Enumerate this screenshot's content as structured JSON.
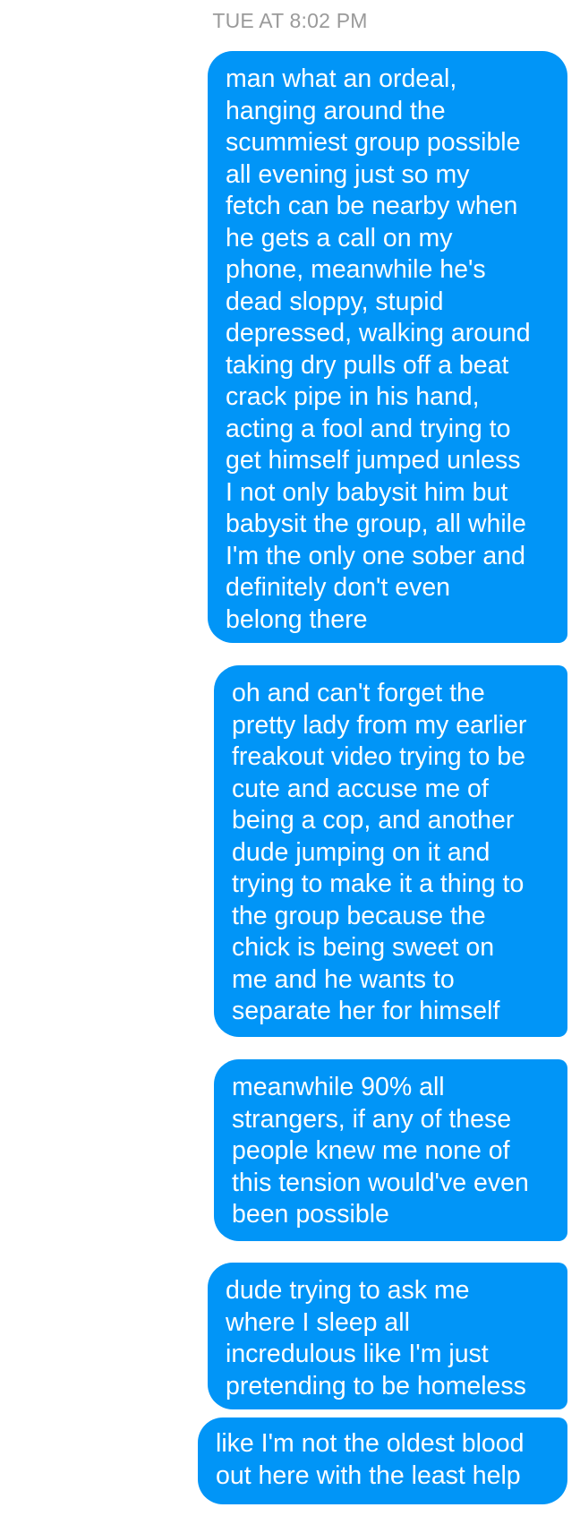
{
  "thread": {
    "timestamp": "TUE AT 8:02 PM",
    "messages": [
      {
        "direction": "outgoing",
        "text": "man what an ordeal,\nhanging around the\nscummiest group possible\nall evening just so my\nfetch can be nearby when\nhe gets a call on my\nphone, meanwhile he's\ndead sloppy, stupid\ndepressed, walking around\ntaking dry pulls off a beat\ncrack pipe in his hand,\nacting a fool and trying to\nget himself jumped unless\nI not only babysit him but\nbabysit the group, all while\nI'm the only one sober and\ndefinitely don't even\nbelong there"
      },
      {
        "direction": "outgoing",
        "text": "oh and can't forget the\npretty lady from my earlier\nfreakout video trying to be\ncute and accuse me of\nbeing a cop, and another\ndude jumping on it and\ntrying to make it a thing to\nthe group because the\nchick is being sweet on\nme and he wants to\nseparate her for himself"
      },
      {
        "direction": "outgoing",
        "text": "meanwhile 90% all\nstrangers, if any of these\npeople knew me none of\nthis tension would've even\nbeen possible"
      },
      {
        "direction": "outgoing",
        "text": "dude trying to ask me\nwhere I sleep all\nincredulous like I'm just\npretending to be homeless"
      },
      {
        "direction": "outgoing",
        "text": "like I'm not the oldest blood\nout here with the least help"
      }
    ]
  },
  "colors": {
    "outgoing_bubble": "#0195f7",
    "outgoing_text": "#ffffff",
    "timestamp_text": "#9a9a9a",
    "background": "#ffffff"
  }
}
